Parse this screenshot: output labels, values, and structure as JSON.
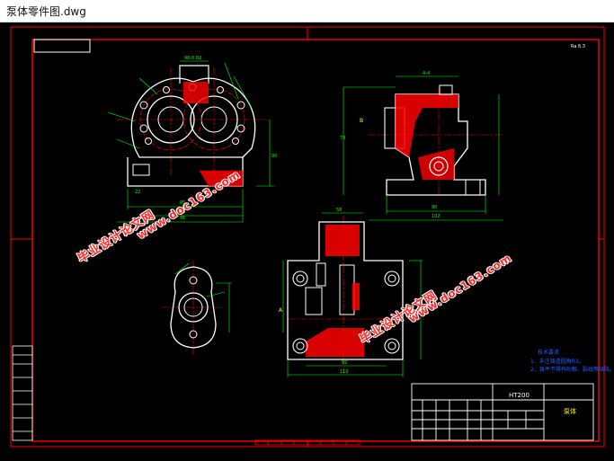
{
  "window": {
    "title": "泵体零件图.dwg"
  },
  "drawing": {
    "title_block": {
      "part_code": "HT200",
      "material": "泵体"
    },
    "tech_requirements": {
      "heading": "技术要求",
      "line1": "1、未注铸造圆角R3。",
      "line2": "2、铸件不得有砂眼、裂纹等缺陷。"
    },
    "corner_mark": "Ra 6.3",
    "section_label_a": "A",
    "section_label_b": "B"
  },
  "watermarks": {
    "cn": "毕业设计论文网",
    "url": "www.doc163.com"
  },
  "colors": {
    "background": "#000000",
    "frame": "#ff0000",
    "outline": "#ffffff",
    "dimension": "#00ff00",
    "section_hatch": "#ff0000",
    "centerline": "#ff0000",
    "annotation": "#2f5bff",
    "highlight_text": "#ffff00"
  }
}
